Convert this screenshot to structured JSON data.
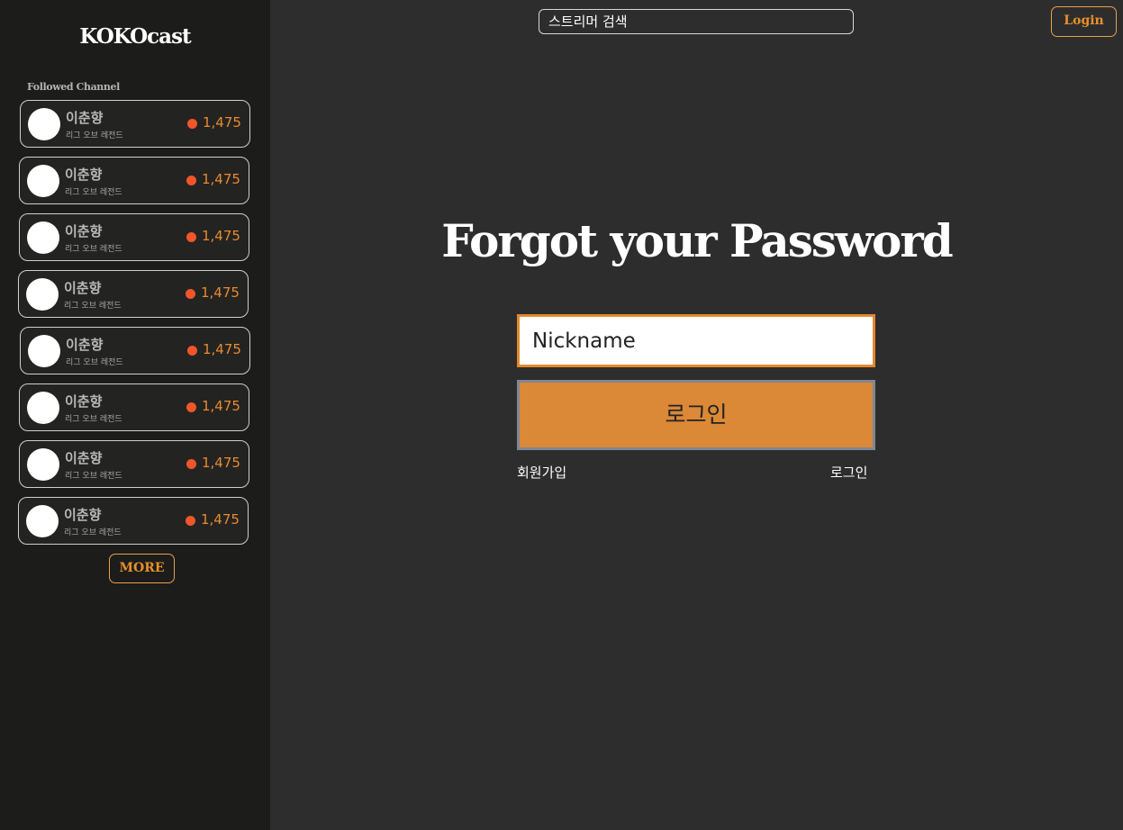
{
  "sidebar": {
    "logo": "KOKOcast",
    "followed_title": "Followed Channel",
    "channels": [
      {
        "name": "이춘향",
        "game": "리그 오브 레전드",
        "viewers": "1,475"
      },
      {
        "name": "이춘향",
        "game": "리그 오브 레전드",
        "viewers": "1,475"
      },
      {
        "name": "이춘향",
        "game": "리그 오브 레전드",
        "viewers": "1,475"
      },
      {
        "name": "이춘향",
        "game": "리그 오브 레전드",
        "viewers": "1,475"
      },
      {
        "name": "이춘향",
        "game": "리그 오브 레전드",
        "viewers": "1,475"
      },
      {
        "name": "이춘향",
        "game": "리그 오브 레전드",
        "viewers": "1,475"
      },
      {
        "name": "이춘향",
        "game": "리그 오브 레전드",
        "viewers": "1,475"
      },
      {
        "name": "이춘향",
        "game": "리그 오브 레전드",
        "viewers": "1,475"
      }
    ],
    "more_label": "MORE"
  },
  "header": {
    "search_placeholder": "스트리머 검색",
    "login_label": "Login"
  },
  "main": {
    "heading": "Forgot your Password",
    "nickname_placeholder": "Nickname",
    "submit_label": "로그인",
    "signup_link": "회원가입",
    "login_link": "로그인"
  },
  "colors": {
    "accent": "#e8902a",
    "live_dot": "#f0562a",
    "button_bg": "#db8837",
    "sidebar_bg": "#1c1c1b",
    "main_bg": "#2d2d2d"
  }
}
